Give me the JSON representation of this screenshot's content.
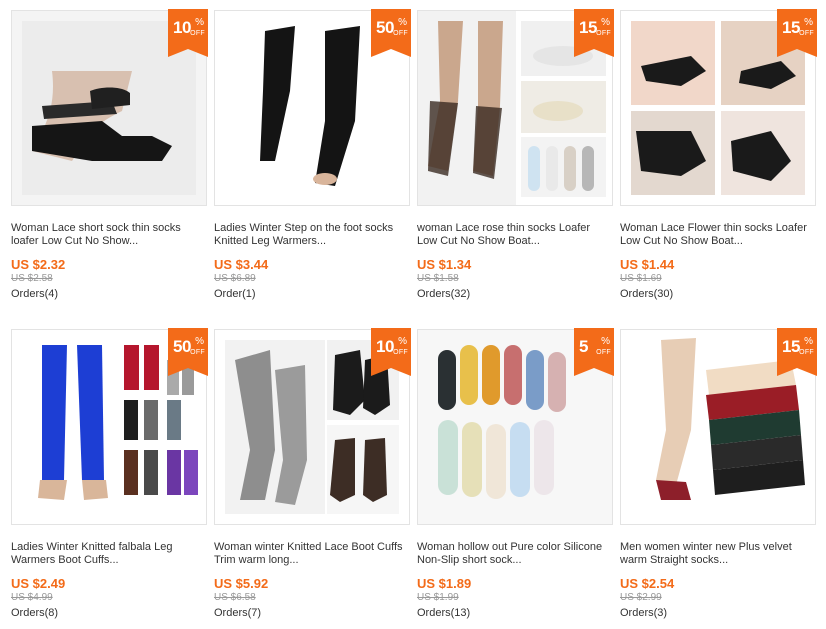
{
  "products": [
    {
      "discount_value": "10",
      "pct": "%",
      "off": "OFF",
      "title": "Woman Lace short sock thin socks loafer Low Cut No Show...",
      "price": "US $2.32",
      "old_price": "US $2.58",
      "orders": "Orders(4)"
    },
    {
      "discount_value": "50",
      "pct": "%",
      "off": "OFF",
      "title": "Ladies Winter Step on the foot socks Knitted Leg Warmers...",
      "price": "US $3.44",
      "old_price": "US $6.89",
      "orders": "Order(1)"
    },
    {
      "discount_value": "15",
      "pct": "%",
      "off": "OFF",
      "title": "woman Lace rose thin socks Loafer Low Cut No Show Boat...",
      "price": "US $1.34",
      "old_price": "US $1.58",
      "orders": "Orders(32)"
    },
    {
      "discount_value": "15",
      "pct": "%",
      "off": "OFF",
      "title": "Woman Lace Flower thin socks Loafer Low Cut No Show Boat...",
      "price": "US $1.44",
      "old_price": "US $1.69",
      "orders": "Orders(30)"
    },
    {
      "discount_value": "50",
      "pct": "%",
      "off": "OFF",
      "title": "Ladies Winter Knitted falbala Leg Warmers Boot Cuffs...",
      "price": "US $2.49",
      "old_price": "US $4.99",
      "orders": "Orders(8)"
    },
    {
      "discount_value": "10",
      "pct": "%",
      "off": "OFF",
      "title": "Woman winter Knitted Lace Boot Cuffs Trim warm long...",
      "price": "US $5.92",
      "old_price": "US $6.58",
      "orders": "Orders(7)"
    },
    {
      "discount_value": "5",
      "pct": "%",
      "off": "OFF",
      "title": "Woman hollow out Pure color Silicone Non-Slip short sock...",
      "price": "US $1.89",
      "old_price": "US $1.99",
      "orders": "Orders(13)"
    },
    {
      "discount_value": "15",
      "pct": "%",
      "off": "OFF",
      "title": "Men women winter new Plus velvet warm Straight socks...",
      "price": "US $2.54",
      "old_price": "US $2.99",
      "orders": "Orders(3)"
    }
  ],
  "colors": {
    "accent": "#f36b19",
    "old_price": "#999999",
    "text": "#333333"
  }
}
